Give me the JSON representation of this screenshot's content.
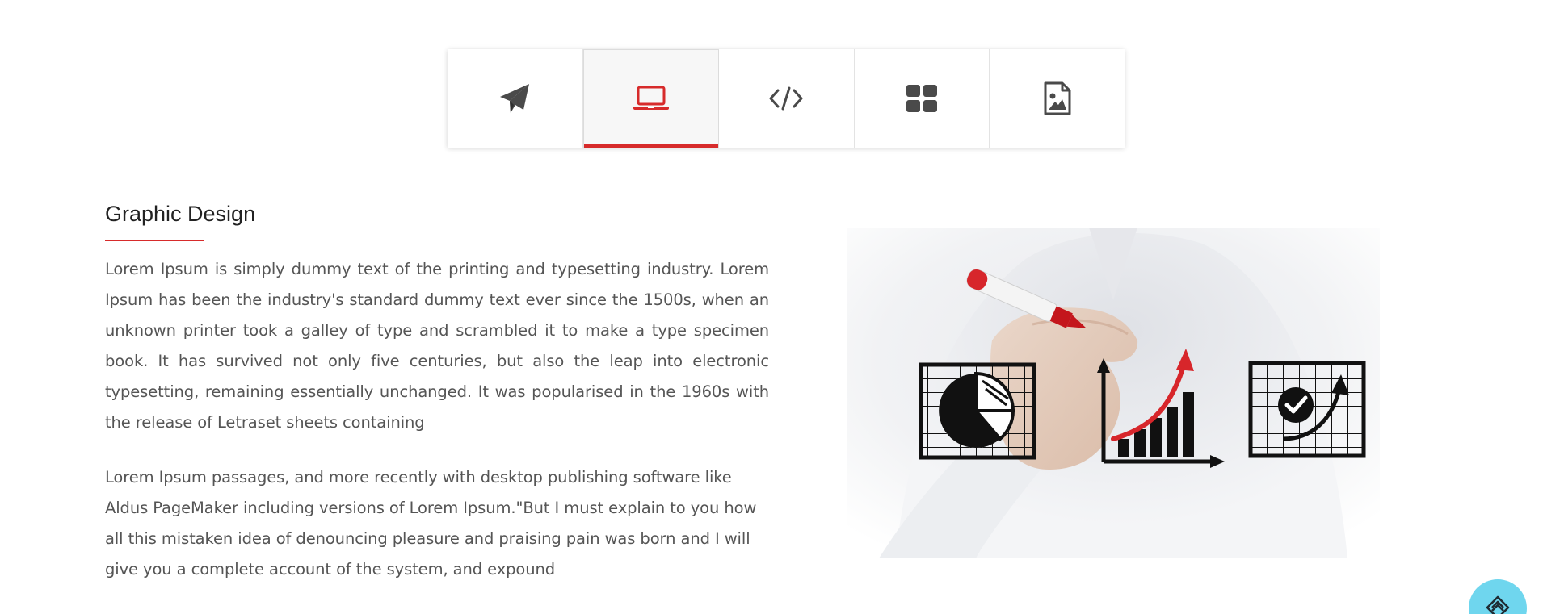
{
  "tabs": [
    {
      "icon": "paper-plane-icon",
      "active": false
    },
    {
      "icon": "laptop-icon",
      "active": true
    },
    {
      "icon": "code-icon",
      "active": false
    },
    {
      "icon": "grid-icon",
      "active": false
    },
    {
      "icon": "image-file-icon",
      "active": false
    }
  ],
  "content": {
    "title": "Graphic Design",
    "paragraph_1": "Lorem Ipsum is simply dummy text of the printing and typesetting industry. Lorem Ipsum has been the industry's standard dummy text ever since the 1500s, when an unknown printer took a galley of type and scrambled it to make a type specimen book. It has survived not only five centuries, but also the leap into electronic typesetting, remaining essentially unchanged. It was popularised in the 1960s with the release of Letraset sheets containing",
    "paragraph_2": "Lorem Ipsum passages, and more recently with desktop publishing software like Aldus PageMaker including versions of Lorem Ipsum.\"But I must explain to you how all this mistaken idea of denouncing pleasure and praising pain was born and I will give you a complete account of the system, and expound"
  },
  "hero_image": {
    "icon": "hand-drawing-charts-image"
  },
  "floating_button": {
    "icon": "layers-diamond-icon"
  },
  "colors": {
    "accent": "#d72b2b",
    "icon_gray": "#4a4a4a",
    "text": "#555555",
    "heading": "#222222",
    "fab": "#6fd6ee"
  }
}
